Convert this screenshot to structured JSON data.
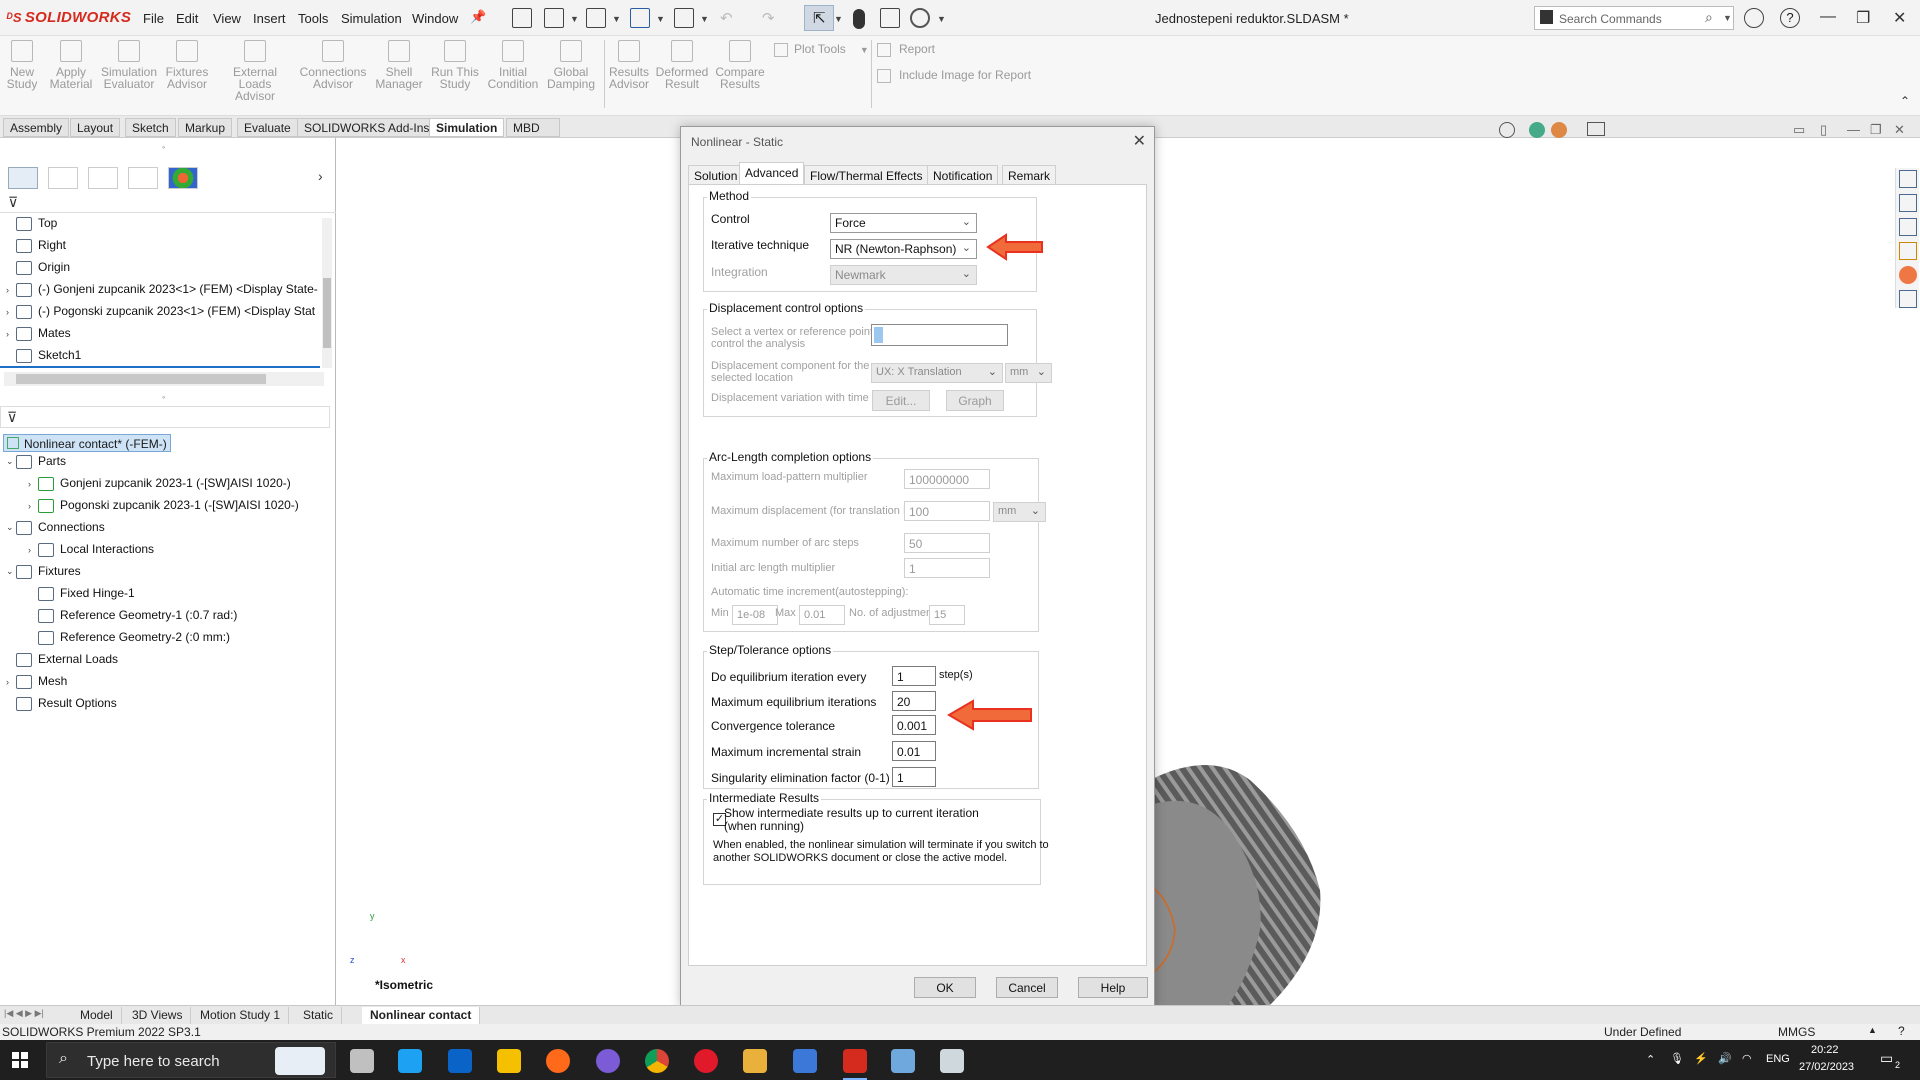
{
  "app": {
    "logo": "SOLIDWORKS",
    "document_title": "Jednostepeni reduktor.SLDASM *",
    "search_placeholder": "Search Commands"
  },
  "menu": [
    "File",
    "Edit",
    "View",
    "Insert",
    "Tools",
    "Simulation",
    "Window"
  ],
  "command_manager": {
    "buttons": [
      {
        "label1": "New",
        "label2": "Study"
      },
      {
        "label1": "Apply",
        "label2": "Material"
      },
      {
        "label1": "Simulation",
        "label2": "Evaluator"
      },
      {
        "label1": "Fixtures",
        "label2": "Advisor"
      },
      {
        "label1": "External Loads",
        "label2": "Advisor"
      },
      {
        "label1": "Connections",
        "label2": "Advisor"
      },
      {
        "label1": "Shell",
        "label2": "Manager"
      },
      {
        "label1": "Run This",
        "label2": "Study"
      },
      {
        "label1": "Initial",
        "label2": "Condition"
      },
      {
        "label1": "Global",
        "label2": "Damping"
      },
      {
        "label1": "Results",
        "label2": "Advisor"
      },
      {
        "label1": "Deformed",
        "label2": "Result"
      },
      {
        "label1": "Compare",
        "label2": "Results"
      }
    ],
    "plot_tools": "Plot Tools",
    "report": "Report",
    "include_image": "Include Image for Report"
  },
  "cm_tabs": [
    {
      "label": "Assembly",
      "active": false
    },
    {
      "label": "Layout",
      "active": false
    },
    {
      "label": "Sketch",
      "active": false
    },
    {
      "label": "Markup",
      "active": false
    },
    {
      "label": "Evaluate",
      "active": false
    },
    {
      "label": "SOLIDWORKS Add-Ins",
      "active": false
    },
    {
      "label": "Simulation",
      "active": true
    },
    {
      "label": "MBD",
      "active": false
    }
  ],
  "feature_tree": [
    {
      "label": "Top",
      "expand": ""
    },
    {
      "label": "Right",
      "expand": ""
    },
    {
      "label": "Origin",
      "expand": ""
    },
    {
      "label": "(-) Gonjeni zupcanik 2023<1> (FEM) <Display State-",
      "expand": "›"
    },
    {
      "label": "(-) Pogonski zupcanik 2023<1> (FEM) <Display Stat",
      "expand": "›"
    },
    {
      "label": "Mates",
      "expand": "›"
    },
    {
      "label": "Sketch1",
      "expand": ""
    }
  ],
  "study_tree": {
    "root": "Nonlinear contact* (-FEM-)",
    "items": [
      {
        "label": "Parts",
        "indent": 1,
        "expand": "⌄"
      },
      {
        "label": "Gonjeni zupcanik 2023-1 (-[SW]AISI 1020-)",
        "indent": 2,
        "expand": "›"
      },
      {
        "label": "Pogonski zupcanik 2023-1 (-[SW]AISI 1020-)",
        "indent": 2,
        "expand": "›"
      },
      {
        "label": "Connections",
        "indent": 1,
        "expand": "⌄"
      },
      {
        "label": "Local Interactions",
        "indent": 2,
        "expand": "›"
      },
      {
        "label": "Fixtures",
        "indent": 1,
        "expand": "⌄"
      },
      {
        "label": "Fixed Hinge-1",
        "indent": 2,
        "expand": ""
      },
      {
        "label": "Reference Geometry-1 (:0.7 rad:)",
        "indent": 2,
        "expand": ""
      },
      {
        "label": "Reference Geometry-2 (:0 mm:)",
        "indent": 2,
        "expand": ""
      },
      {
        "label": "External Loads",
        "indent": 1,
        "expand": ""
      },
      {
        "label": "Mesh",
        "indent": 1,
        "expand": "›"
      },
      {
        "label": "Result Options",
        "indent": 1,
        "expand": ""
      }
    ]
  },
  "view_label": "*Isometric",
  "triad": {
    "x": "x",
    "y": "y",
    "z": "z"
  },
  "dialog": {
    "title": "Nonlinear - Static",
    "tabs": [
      "Solution",
      "Advanced",
      "Flow/Thermal Effects",
      "Notification",
      "Remark"
    ],
    "active_tab": "Advanced",
    "method": {
      "group": "Method",
      "control_label": "Control",
      "control_value": "Force",
      "iterative_label": "Iterative technique",
      "iterative_value": "NR (Newton-Raphson)",
      "integration_label": "Integration",
      "integration_value": "Newmark"
    },
    "displacement": {
      "group": "Displacement control options",
      "vertex_label1": "Select a vertex or reference point to",
      "vertex_label2": "control the analysis",
      "component_label1": "Displacement component for the",
      "component_label2": "selected location",
      "component_value": "UX: X Translation",
      "unit_value": "mm",
      "variation_label": "Displacement variation with time",
      "edit_button": "Edit...",
      "graph_button": "Graph"
    },
    "arc": {
      "group": "Arc-Length completion options",
      "max_load_label": "Maximum load-pattern multiplier",
      "max_load_value": "100000000",
      "max_disp_label": "Maximum displacement (for translation DOF)",
      "max_disp_value": "100",
      "max_disp_unit": "mm",
      "max_steps_label": "Maximum number of arc steps",
      "max_steps_value": "50",
      "initial_label": "Initial arc length multiplier",
      "initial_value": "1",
      "auto_label": "Automatic time increment(autostepping):",
      "min_label": "Min",
      "min_value": "1e-08",
      "max_label": "Max",
      "max_value": "0.01",
      "adj_label": "No. of adjustments",
      "adj_value": "15"
    },
    "step": {
      "group": "Step/Tolerance options",
      "every_label": "Do equilibrium iteration every",
      "every_value": "1",
      "every_unit": "step(s)",
      "max_iter_label": "Maximum equilibrium iterations",
      "max_iter_value": "20",
      "conv_label": "Convergence tolerance",
      "conv_value": "0.001",
      "strain_label": "Maximum incremental strain",
      "strain_value": "0.01",
      "sing_label": "Singularity elimination factor (0-1)",
      "sing_value": "1"
    },
    "intermediate": {
      "group": "Intermediate Results",
      "checkbox_label1": "Show intermediate results up to current iteration",
      "checkbox_label2": "(when running)",
      "checked": true,
      "note1": "When enabled, the nonlinear simulation will terminate if you switch to",
      "note2": "another SOLIDWORKS document or close the active model."
    },
    "ok": "OK",
    "cancel": "Cancel",
    "help": "Help"
  },
  "bottom_tabs": [
    {
      "label": "Model",
      "active": false
    },
    {
      "label": "3D Views",
      "active": false
    },
    {
      "label": "Motion Study 1",
      "active": false
    },
    {
      "label": "Static",
      "active": false
    },
    {
      "label": "Nonlinear contact",
      "active": true
    }
  ],
  "status": {
    "left": "SOLIDWORKS Premium 2022 SP3.1",
    "state": "Under Defined",
    "units": "MMGS"
  },
  "taskbar": {
    "search_placeholder": "Type here to search",
    "lang": "ENG",
    "time": "20:22",
    "date": "27/02/2023",
    "notif_count": "2"
  },
  "colors": {
    "accent_red": "#d52b1e",
    "arrow_red": "#e8321f",
    "arrow_fill": "#f06a3a",
    "selection_blue": "#cfe3f7"
  }
}
